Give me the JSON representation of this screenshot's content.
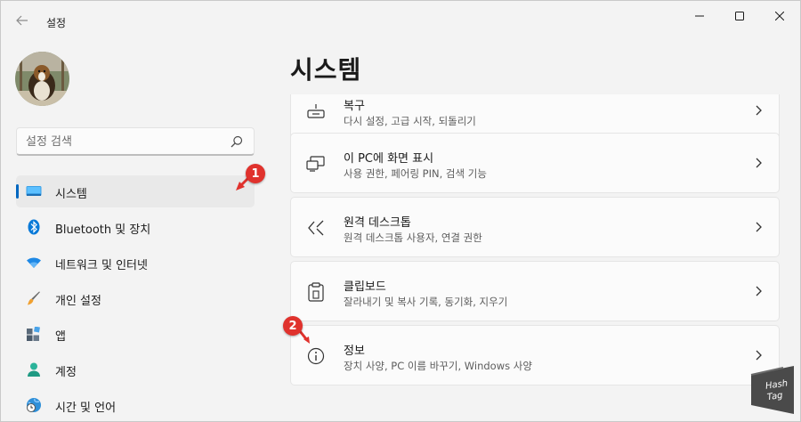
{
  "app": {
    "title": "설정"
  },
  "search": {
    "placeholder": "설정 검색"
  },
  "sidebar": {
    "items": [
      {
        "label": "시스템",
        "icon": "monitor-icon",
        "active": true
      },
      {
        "label": "Bluetooth 및 장치",
        "icon": "bluetooth-icon"
      },
      {
        "label": "네트워크 및 인터넷",
        "icon": "wifi-icon"
      },
      {
        "label": "개인 설정",
        "icon": "brush-icon"
      },
      {
        "label": "앱",
        "icon": "apps-icon"
      },
      {
        "label": "계정",
        "icon": "person-icon"
      },
      {
        "label": "시간 및 언어",
        "icon": "clock-globe-icon"
      }
    ]
  },
  "main": {
    "title": "시스템",
    "cards": [
      {
        "title": "복구",
        "subtitle": "다시 설정, 고급 시작, 되돌리기",
        "icon": "recovery-icon"
      },
      {
        "title": "이 PC에 화면 표시",
        "subtitle": "사용 권한, 페어링 PIN, 검색 기능",
        "icon": "project-icon"
      },
      {
        "title": "원격 데스크톱",
        "subtitle": "원격 데스크톱 사용자, 연결 권한",
        "icon": "remote-desktop-icon"
      },
      {
        "title": "클립보드",
        "subtitle": "잘라내기 및 복사 기록, 동기화, 지우기",
        "icon": "clipboard-icon"
      },
      {
        "title": "정보",
        "subtitle": "장치 사양, PC 이름 바꾸기, Windows 사양",
        "icon": "info-icon"
      }
    ]
  },
  "annotations": {
    "marker1": "1",
    "marker2": "2"
  },
  "watermark": {
    "line1": "Hash",
    "line2": "Tag"
  },
  "colors": {
    "accent": "#0067c0",
    "marker": "#e0322d"
  }
}
